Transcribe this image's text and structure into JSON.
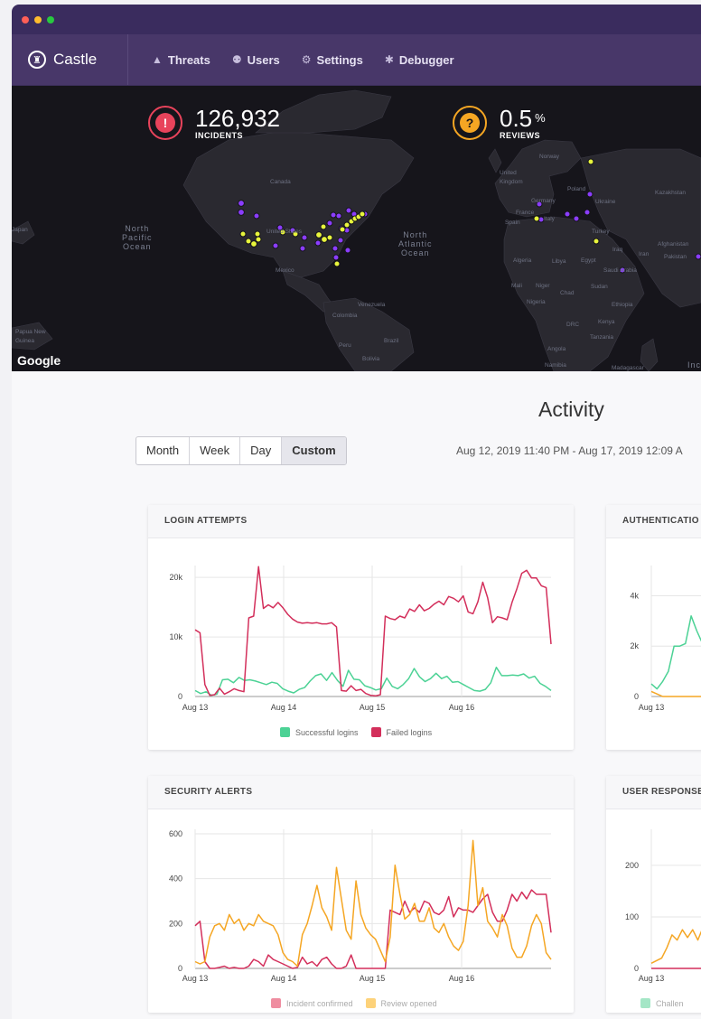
{
  "app": {
    "brand": "Castle",
    "nav": [
      {
        "label": "Threats",
        "icon": "warning-icon"
      },
      {
        "label": "Users",
        "icon": "users-icon"
      },
      {
        "label": "Settings",
        "icon": "gear-icon"
      },
      {
        "label": "Debugger",
        "icon": "bug-icon"
      }
    ]
  },
  "map": {
    "provider": "Google",
    "incidents": {
      "value": "126,932",
      "label": "INCIDENTS",
      "icon": "alert-icon",
      "color": "#e8435b"
    },
    "reviews": {
      "value": "0.5",
      "unit": "%",
      "label": "REVIEWS",
      "icon": "question-icon",
      "color": "#f5a623"
    },
    "labels": {
      "npo": [
        "North",
        "Pacific",
        "Ocean"
      ],
      "nao": [
        "North",
        "Atlantic",
        "Ocean"
      ],
      "canada": "Canada",
      "us": "United States",
      "mexico": "Mexico",
      "venezuela": "Venezuela",
      "colombia": "Colombia",
      "brazil": "Brazil",
      "peru": "Peru",
      "bolivia": "Bolivia",
      "uk": [
        "United",
        "Kingdom"
      ],
      "norway": "Norway",
      "poland": "Poland",
      "germany": "Germany",
      "ukraine": "Ukraine",
      "france": "France",
      "spain": "Spain",
      "italy": "Italy",
      "turkey": "Turkey",
      "kazakhstan": "Kazakhstan",
      "iraq": "Iraq",
      "iran": "Iran",
      "afghanistan": "Afghanistan",
      "pakistan": "Pakistan",
      "algeria": "Algeria",
      "libya": "Libya",
      "egypt": "Egypt",
      "saudi": "Saudi Arabia",
      "mali": "Mali",
      "niger": "Niger",
      "chad": "Chad",
      "sudan": "Sudan",
      "nigeria": "Nigeria",
      "ethiopia": "Ethiopia",
      "drc": "DRC",
      "kenya": "Kenya",
      "tanzania": "Tanzania",
      "angola": "Angola",
      "namibia": "Namibia",
      "madagascar": "Madagascar",
      "papua": [
        "Papua New",
        "Guinea"
      ],
      "japan": "Japan",
      "india_partial": "Inc"
    },
    "colors": {
      "purple": "#8b3dff",
      "yellow": "#e8f53c"
    }
  },
  "activity": {
    "title": "Activity",
    "periods": [
      "Month",
      "Week",
      "Day",
      "Custom"
    ],
    "active_period": "Custom",
    "date_range": "Aug 12, 2019 11:40 PM - Aug 17, 2019 12:09 A"
  },
  "charts": {
    "login": {
      "title": "LOGIN ATTEMPTS",
      "legend": [
        {
          "label": "Successful logins",
          "color": "#4cd295"
        },
        {
          "label": "Failed logins",
          "color": "#d32f5b"
        }
      ]
    },
    "auth": {
      "title": "AUTHENTICATIO"
    },
    "security": {
      "title": "SECURITY ALERTS",
      "legend": [
        {
          "label": "Incident confirmed",
          "color": "#ef8da0"
        },
        {
          "label": "Review opened",
          "color": "#fdd27a"
        }
      ]
    },
    "user_resp": {
      "title": "USER RESPONSE",
      "legend": [
        {
          "label": "Challen",
          "color": "#a4e6c6"
        }
      ]
    }
  },
  "chart_data": [
    {
      "type": "line",
      "title": "LOGIN ATTEMPTS",
      "x_ticks": [
        "Aug 13",
        "Aug 14",
        "Aug 15",
        "Aug 16"
      ],
      "y_ticks": [
        "0",
        "10k",
        "20k"
      ],
      "ylim": [
        0,
        22000
      ],
      "series": [
        {
          "name": "Successful logins",
          "color": "#4cd295",
          "values": [
            1000,
            500,
            800,
            200,
            400,
            2800,
            2900,
            2300,
            3200,
            2700,
            2800,
            2600,
            2300,
            2000,
            2400,
            2200,
            1300,
            900,
            600,
            1200,
            1500,
            2600,
            3500,
            3800,
            2700,
            4000,
            2700,
            1700,
            4400,
            2900,
            2800,
            1800,
            1500,
            1100,
            1300,
            3100,
            1700,
            1300,
            2000,
            3000,
            4700,
            3300,
            2500,
            3000,
            3900,
            3000,
            3400,
            2400,
            2500,
            2000,
            1500,
            1000,
            900,
            1200,
            2300,
            4900,
            3500,
            3500,
            3600,
            3500,
            3800,
            3100,
            3400,
            2200,
            1700,
            1000
          ]
        },
        {
          "name": "Failed logins",
          "color": "#d32f5b",
          "values": [
            11200,
            10700,
            2000,
            200,
            300,
            1400,
            400,
            800,
            1300,
            1000,
            800,
            13200,
            13500,
            21800,
            14800,
            15400,
            14900,
            15800,
            14900,
            13800,
            13000,
            12500,
            12300,
            12400,
            12300,
            12400,
            12200,
            12200,
            12400,
            11700,
            1000,
            900,
            1800,
            1000,
            1200,
            500,
            200,
            100,
            300,
            13500,
            13100,
            12900,
            13500,
            13200,
            14700,
            14300,
            15400,
            14400,
            14800,
            15500,
            16000,
            15400,
            16800,
            16500,
            15900,
            16900,
            14200,
            13900,
            15900,
            19200,
            16600,
            12400,
            13400,
            13200,
            12900,
            15800,
            18100,
            20700,
            21200,
            19900,
            19900,
            18600,
            18300,
            8800
          ]
        }
      ]
    },
    {
      "type": "line",
      "title": "AUTHENTICATIO",
      "x_ticks": [
        "Aug 13"
      ],
      "y_ticks": [
        "0",
        "2k",
        "4k"
      ],
      "ylim": [
        0,
        5200
      ],
      "series": [
        {
          "name": "",
          "color": "#4cd295",
          "values": [
            500,
            300,
            600,
            1000,
            2000,
            2000,
            2100,
            3200,
            2600,
            2100,
            2500
          ]
        },
        {
          "name": "",
          "color": "#f5a623",
          "values": [
            200,
            100,
            0,
            0,
            0,
            0,
            0,
            0,
            0,
            0,
            0
          ]
        }
      ]
    },
    {
      "type": "line",
      "title": "SECURITY ALERTS",
      "x_ticks": [
        "Aug 13",
        "Aug 14",
        "Aug 15",
        "Aug 16"
      ],
      "y_ticks": [
        "0",
        "200",
        "400",
        "600"
      ],
      "ylim": [
        0,
        620
      ],
      "series": [
        {
          "name": "Incident confirmed",
          "color": "#d32f5b",
          "values": [
            190,
            210,
            30,
            0,
            0,
            5,
            10,
            0,
            5,
            0,
            0,
            10,
            40,
            30,
            10,
            60,
            40,
            30,
            20,
            10,
            0,
            5,
            50,
            20,
            30,
            10,
            40,
            50,
            20,
            0,
            0,
            10,
            60,
            0,
            0,
            0,
            0,
            0,
            0,
            0,
            260,
            250,
            240,
            300,
            250,
            270,
            250,
            300,
            290,
            250,
            240,
            260,
            320,
            230,
            270,
            260,
            260,
            250,
            280,
            310,
            330,
            250,
            210,
            210,
            260,
            330,
            300,
            340,
            310,
            350,
            330,
            330,
            330,
            160
          ]
        },
        {
          "name": "Review opened",
          "color": "#f5a623",
          "values": [
            30,
            20,
            30,
            140,
            190,
            200,
            170,
            240,
            200,
            220,
            170,
            200,
            190,
            240,
            210,
            200,
            190,
            150,
            70,
            40,
            30,
            10,
            150,
            200,
            280,
            370,
            270,
            230,
            170,
            450,
            310,
            170,
            130,
            390,
            240,
            180,
            150,
            130,
            80,
            30,
            140,
            460,
            330,
            220,
            240,
            290,
            210,
            210,
            270,
            180,
            160,
            200,
            140,
            100,
            80,
            120,
            280,
            570,
            280,
            360,
            210,
            180,
            140,
            240,
            190,
            90,
            50,
            50,
            100,
            190,
            240,
            200,
            70,
            40
          ]
        }
      ]
    },
    {
      "type": "line",
      "title": "USER RESPONSE",
      "x_ticks": [
        "Aug 13"
      ],
      "y_ticks": [
        "0",
        "100",
        "200"
      ],
      "ylim": [
        0,
        270
      ],
      "series": [
        {
          "name": "",
          "color": "#f5a623",
          "values": [
            10,
            15,
            20,
            40,
            65,
            55,
            75,
            60,
            75,
            55,
            80,
            85
          ]
        },
        {
          "name": "",
          "color": "#d32f5b",
          "values": [
            0,
            0,
            0,
            0,
            0,
            0,
            0,
            0,
            0,
            0,
            0,
            0
          ]
        }
      ]
    }
  ]
}
